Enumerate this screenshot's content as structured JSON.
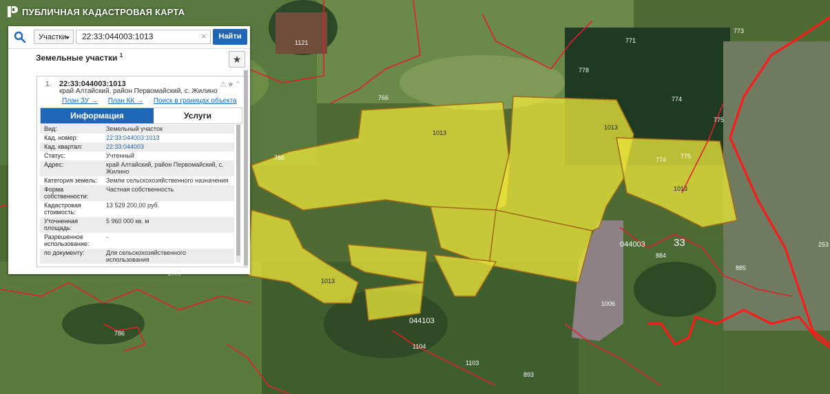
{
  "app": {
    "title": "ПУБЛИЧНАЯ КАДАСТРОВАЯ КАРТА"
  },
  "search": {
    "type_label": "Участки",
    "query": "22:33:044003:1013",
    "find_label": "Найти"
  },
  "results": {
    "header": "Земельные участки",
    "header_count": "1"
  },
  "parcel": {
    "index": "1.",
    "number": "22:33:044003:1013",
    "address": "край Алтайский, район Первомайский, с. Жилино",
    "links": [
      "План ЗУ →",
      "План КК →",
      "Поиск в границах объекта →"
    ],
    "tabs": [
      "Информация",
      "Услуги"
    ],
    "info": [
      {
        "k": "Вид:",
        "v": "Земельный участок",
        "link": false
      },
      {
        "k": "Кад. номер:",
        "v": "22:33:044003:1013",
        "link": true
      },
      {
        "k": "Кад. квартал:",
        "v": "22:33:044003",
        "link": true
      },
      {
        "k": "Статус:",
        "v": "Учтенный",
        "link": false
      },
      {
        "k": "Адрес:",
        "v": "край Алтайский, район Первомайский, с. Жилино",
        "link": false
      },
      {
        "k": "Категория земель:",
        "v": "Земли сельскохозяйственного назначения",
        "link": false
      },
      {
        "k": "Форма собственности:",
        "v": "Частная собственность",
        "link": false
      },
      {
        "k": "Кадастровая стоимость:",
        "v": "13 529 200,00 руб.",
        "link": false
      },
      {
        "k": "Уточненная площадь:",
        "v": "5 960 000 кв. м",
        "link": false
      },
      {
        "k": "Разрешенное использование:",
        "v": "-",
        "link": false
      },
      {
        "k": "по документу:",
        "v": "Для сельскохозяйственного использования",
        "link": false
      }
    ]
  },
  "map_labels": [
    "1121",
    "1121",
    "773",
    "771",
    "774",
    "775",
    "774",
    "775",
    "766",
    "766",
    "1013",
    "1013",
    "1013",
    "1013",
    "044003",
    "33",
    "884",
    "885",
    "253",
    "1006",
    "1006",
    "786",
    "044103",
    "1104",
    "1103",
    "893",
    "778"
  ],
  "colors": {
    "accent": "#1f67b6",
    "parcel_fill": "#e8e33a",
    "boundary": "#e0202a"
  }
}
